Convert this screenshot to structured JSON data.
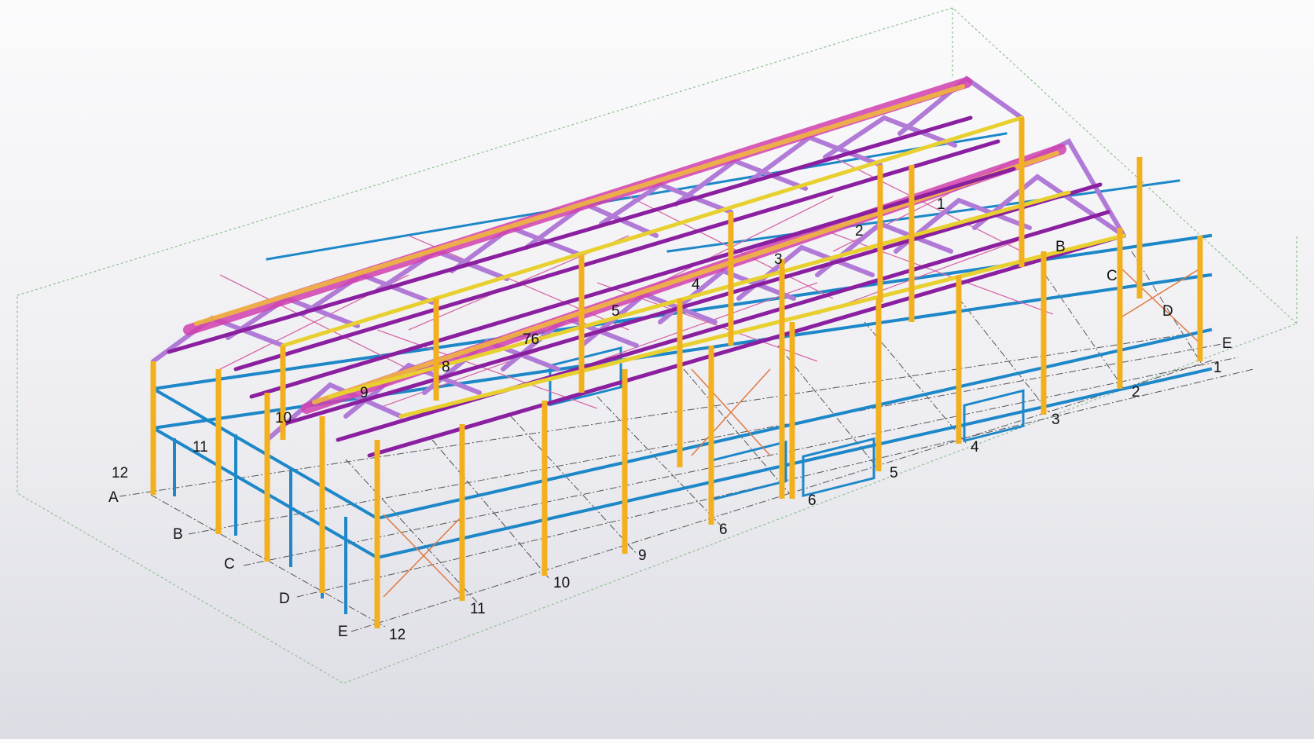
{
  "scene": {
    "colors": {
      "background_top": "#fbfbfc",
      "background_bottom": "#dcdde4",
      "column": "#f2b01e",
      "wall_member": "#1d87c8",
      "roof_rafter": "#b07ad6",
      "purlin": "#8a1fa0",
      "eave_beam": "#e8d030",
      "bracing": "#d86aa8",
      "wall_bracing": "#e07a40",
      "grid_line": "#555555",
      "bounding_box": "#8fbf8f"
    },
    "grid_axes_numbers": [
      "12",
      "11",
      "10",
      "9",
      "6",
      "5",
      "4",
      "3",
      "2",
      "1"
    ],
    "grid_axes_letters": [
      "A",
      "B",
      "C",
      "D",
      "E"
    ],
    "labels": {
      "front": {
        "n12": "12",
        "n11": "11",
        "n10": "10",
        "n9": "9",
        "n6a": "6",
        "n6b": "6",
        "n5": "5",
        "n4": "4",
        "n3": "3",
        "n2": "2",
        "n1": "1"
      },
      "left": {
        "A": "A",
        "B": "B",
        "C": "C",
        "D": "D",
        "E": "E",
        "n12": "12"
      },
      "right": {
        "B": "B",
        "C": "C",
        "D": "D",
        "E": "E"
      },
      "top": {
        "n1": "1",
        "n2": "2",
        "n3": "3",
        "n4": "4",
        "n5": "5",
        "n76": "76",
        "n8": "8",
        "n9": "9",
        "n10": "10",
        "n11": "11"
      }
    }
  }
}
